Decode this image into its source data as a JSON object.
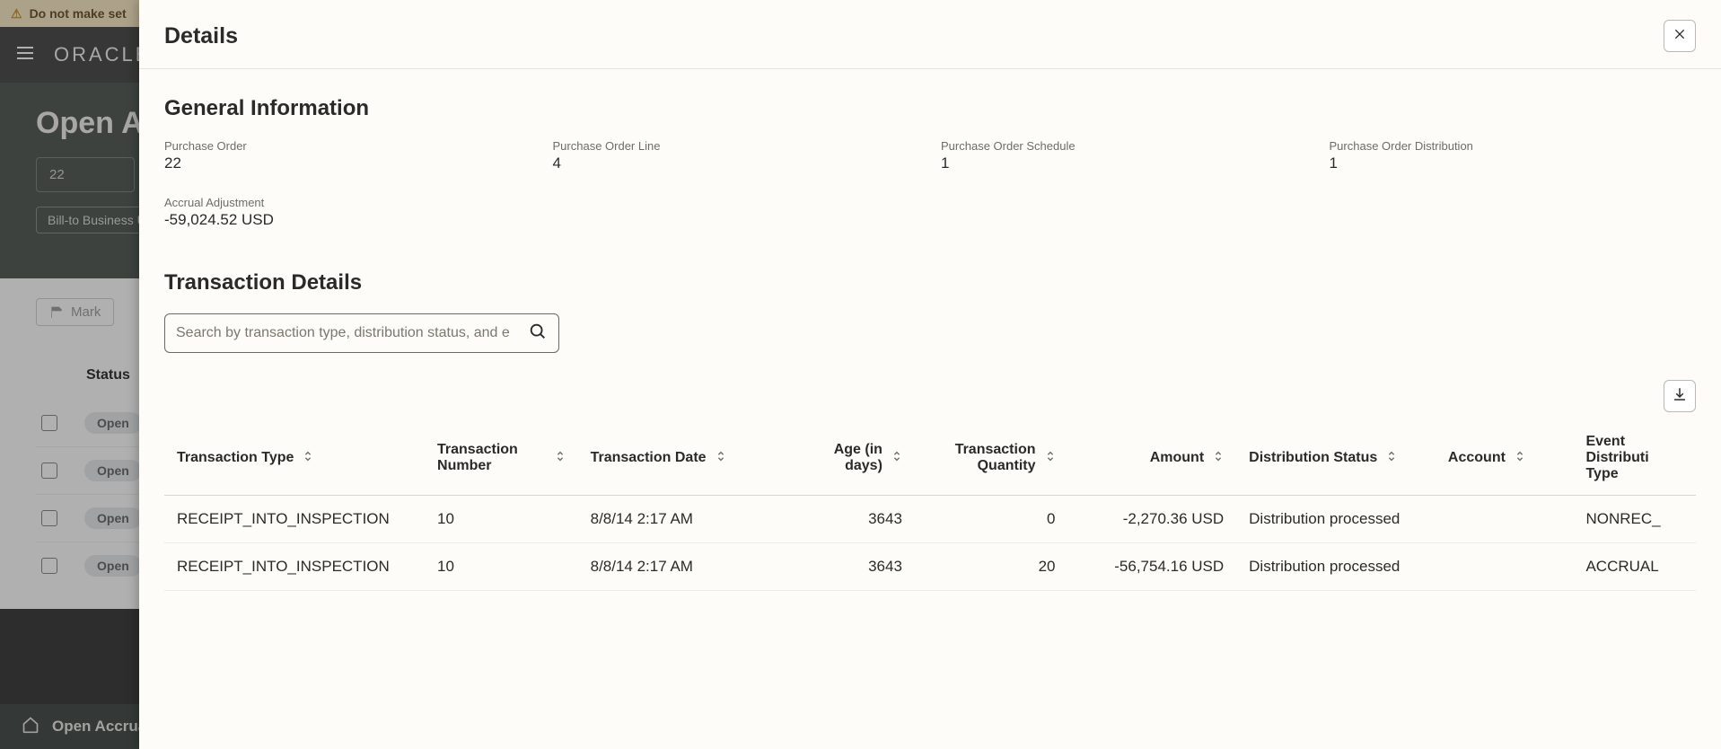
{
  "background": {
    "warning_text": "Do not make set",
    "logo_text": "ORACLE",
    "page_title": "Open Ac",
    "search_value": "22",
    "filter_pill": "Bill-to Business U",
    "mark_button": "Mark",
    "status_header": "Status",
    "row_status": "Open",
    "bottom_bar": "Open Accrual"
  },
  "panel": {
    "title": "Details",
    "general": {
      "title": "General Information",
      "fields": {
        "po_label": "Purchase Order",
        "po_value": "22",
        "pol_label": "Purchase Order Line",
        "pol_value": "4",
        "pos_label": "Purchase Order Schedule",
        "pos_value": "1",
        "pod_label": "Purchase Order Distribution",
        "pod_value": "1",
        "adj_label": "Accrual Adjustment",
        "adj_value": "-59,024.52 USD"
      }
    },
    "transactions": {
      "title": "Transaction Details",
      "search_placeholder": "Search by transaction type, distribution status, and e",
      "columns": {
        "txn_type": "Transaction Type",
        "txn_number": "Transaction Number",
        "txn_date": "Transaction Date",
        "age": "Age (in days)",
        "txn_qty": "Transaction Quantity",
        "amount": "Amount",
        "dist_status": "Distribution Status",
        "account": "Account",
        "event_dist_type": "Event Distributi Type"
      },
      "rows": [
        {
          "type": "RECEIPT_INTO_INSPECTION",
          "number": "10",
          "date": "8/8/14 2:17 AM",
          "age": "3643",
          "qty": "0",
          "amount": "-2,270.36 USD",
          "dist_status": "Distribution processed",
          "account": "",
          "event_type": "NONREC_"
        },
        {
          "type": "RECEIPT_INTO_INSPECTION",
          "number": "10",
          "date": "8/8/14 2:17 AM",
          "age": "3643",
          "qty": "20",
          "amount": "-56,754.16 USD",
          "dist_status": "Distribution processed",
          "account": "",
          "event_type": "ACCRUAL"
        }
      ]
    }
  }
}
